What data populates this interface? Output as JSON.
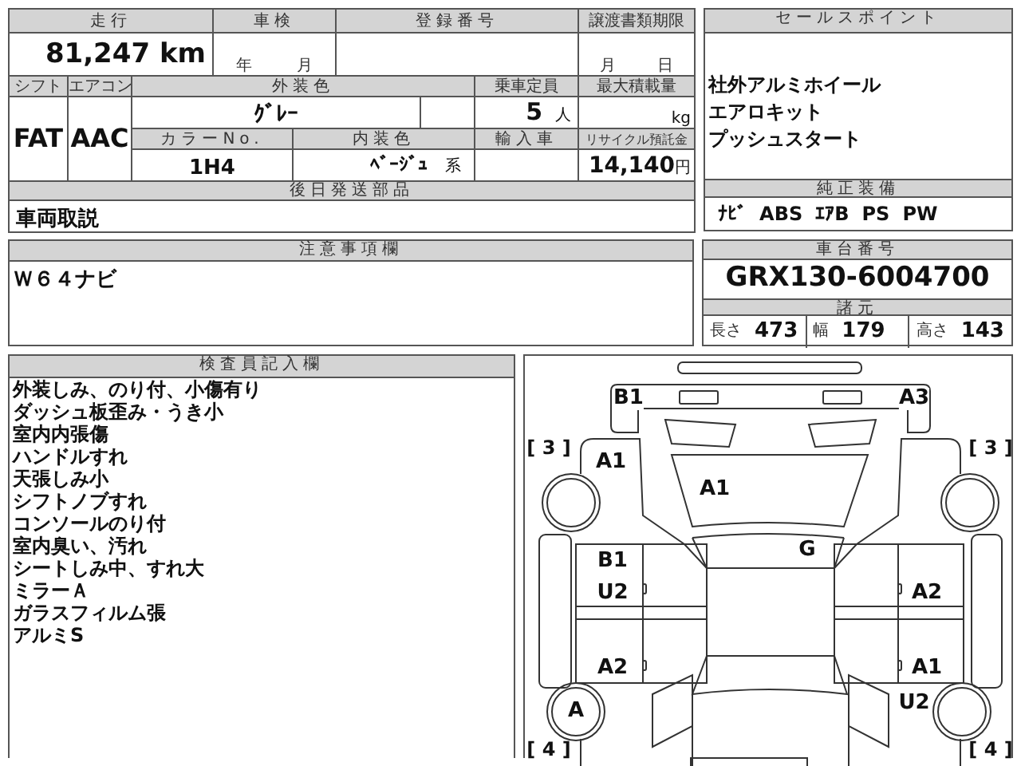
{
  "mileage": {
    "label": "走行",
    "value": "81,247",
    "unit": "km"
  },
  "shaken": {
    "label": "車検",
    "year_unit": "年",
    "month_unit": "月"
  },
  "registration_number": {
    "label": "登録番号"
  },
  "transfer_deadline": {
    "label": "譲渡書類期限",
    "month_unit": "月",
    "day_unit": "日"
  },
  "shift": {
    "label": "シフト",
    "value": "FAT"
  },
  "aircon": {
    "label": "エアコン",
    "value": "AAC"
  },
  "exterior_color": {
    "label": "外装色",
    "value": "ｸﾞﾚｰ"
  },
  "capacity": {
    "label": "乗車定員",
    "value": "5",
    "unit": "人"
  },
  "max_load": {
    "label": "最大積載量",
    "unit": "kg"
  },
  "color_no": {
    "label": "カラーNo.",
    "value": "1H4"
  },
  "interior_color": {
    "label": "内装色",
    "value": "ﾍﾞｰｼﾞｭ",
    "suffix": "系"
  },
  "import_car": {
    "label": "輸入車"
  },
  "recycle_fee": {
    "label": "リサイクル預託金",
    "value": "14,140",
    "unit": "円"
  },
  "parts_to_follow": {
    "label": "後日発送部品",
    "value": "車両取説"
  },
  "sales_points": {
    "label": "セールスポイント",
    "lines": [
      "社外アルミホイール",
      "エアロキット",
      "プッシュスタート"
    ]
  },
  "genuine_equipment": {
    "label": "純正装備",
    "items": [
      "ﾅﾋﾞ",
      "ABS",
      "ｴｱB",
      "PS",
      "PW"
    ]
  },
  "notes": {
    "label": "注意事項欄",
    "lines": [
      "Ｗ６４ナビ"
    ]
  },
  "chassis_number": {
    "label": "車台番号",
    "value": "GRX130-6004700"
  },
  "specs": {
    "label": "諸元",
    "items": [
      {
        "label": "長さ",
        "value": "473"
      },
      {
        "label": "幅",
        "value": "179"
      },
      {
        "label": "高さ",
        "value": "143"
      }
    ]
  },
  "inspector_notes": {
    "label": "検査員記入欄",
    "lines": [
      "外装しみ、のり付、小傷有り",
      "ダッシュ板歪み・うき小",
      "室内内張傷",
      "ハンドルすれ",
      "天張しみ小",
      "シフトノブすれ",
      "コンソールのり付",
      "室内臭い、汚れ",
      "シートしみ中、すれ大",
      "ミラーＡ",
      "ガラスフィルム張",
      "アルミS"
    ]
  },
  "diagram": {
    "zones": {
      "upper_left": "[ 3 ]",
      "upper_right": "[ 3 ]",
      "lower_left": "[ 4 ]",
      "lower_right": "[ 4 ]"
    },
    "marks": {
      "bumper_left": "B1",
      "bumper_right": "A3",
      "fender_upper_left": "A1",
      "hood": "A1",
      "windshield": "G",
      "door_front_left_a": "B1",
      "door_front_left_b": "U2",
      "door_front_right": "A2",
      "door_rear_left": "A2",
      "door_rear_right": "A1",
      "wheel_lower_left": "A",
      "fender_lower_right": "U2"
    }
  }
}
